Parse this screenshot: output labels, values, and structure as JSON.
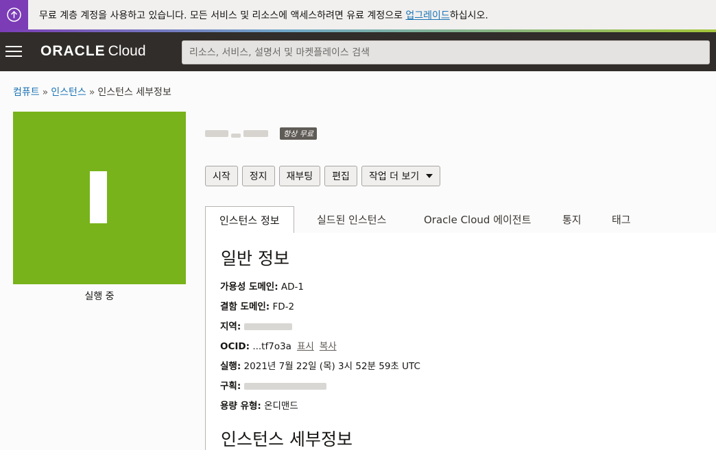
{
  "banner": {
    "text_before": "무료 계층 계정을 사용하고 있습니다. 모든 서비스 및 리소스에 액세스하려면 유료 계정으로 ",
    "link": "업그레이드",
    "text_after": "하십시오.",
    "icon": "upgrade-arrow-icon",
    "accent_color": "#7b3cb6"
  },
  "header": {
    "logo_oracle": "ORACLE",
    "logo_cloud": "Cloud",
    "search_placeholder": "리소스, 서비스, 설명서 및 마켓플레이스 검색"
  },
  "breadcrumb": {
    "items": [
      "컴퓨트",
      "인스턴스",
      "인스턴스 세부정보"
    ],
    "separator": "»"
  },
  "instance": {
    "tile_letter": "I",
    "tile_color": "#78b31b",
    "status": "실행 중",
    "badge": "항상 무료"
  },
  "actions": [
    "시작",
    "정지",
    "재부팅",
    "편집",
    "작업 더 보기"
  ],
  "tabs": [
    "인스턴스 정보",
    "실드된 인스턴스",
    "Oracle Cloud 에이전트",
    "통지",
    "태그"
  ],
  "general": {
    "heading": "일반 정보",
    "availability_domain_label": "가용성 도메인:",
    "availability_domain_value": "AD-1",
    "fault_domain_label": "결함 도메인:",
    "fault_domain_value": "FD-2",
    "region_label": "지역:",
    "ocid_label": "OCID:",
    "ocid_value": "...tf7o3a",
    "ocid_show": "표시",
    "ocid_copy": "복사",
    "launched_label": "실행:",
    "launched_value": "2021년 7월 22일 (목) 3시 52분 59초 UTC",
    "compartment_label": "구획:",
    "capacity_label": "용량 유형:",
    "capacity_value": "온디맨드"
  },
  "details": {
    "heading": "인스턴스 세부정보"
  }
}
